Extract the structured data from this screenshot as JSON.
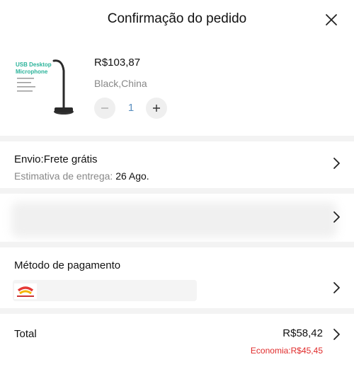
{
  "header": {
    "title": "Confirmação do pedido"
  },
  "product": {
    "image_text": {
      "line1": "USB Desktop",
      "line2": "Microphone"
    },
    "price": "R$103,87",
    "variant": "Black,China",
    "quantity": "1"
  },
  "shipping": {
    "title": "Envio:Frete grátis",
    "estimate_label": "Estimativa de entrega:",
    "estimate_date": "26 Ago."
  },
  "payment": {
    "title": "Método de pagamento"
  },
  "summary": {
    "total_label": "Total",
    "total_value": "R$58,42",
    "saving": "Economia:R$45,45"
  },
  "colors": {
    "saving": "#e02b2b",
    "quantity": "#5a8fbf",
    "separator": "#f3f3f3"
  }
}
